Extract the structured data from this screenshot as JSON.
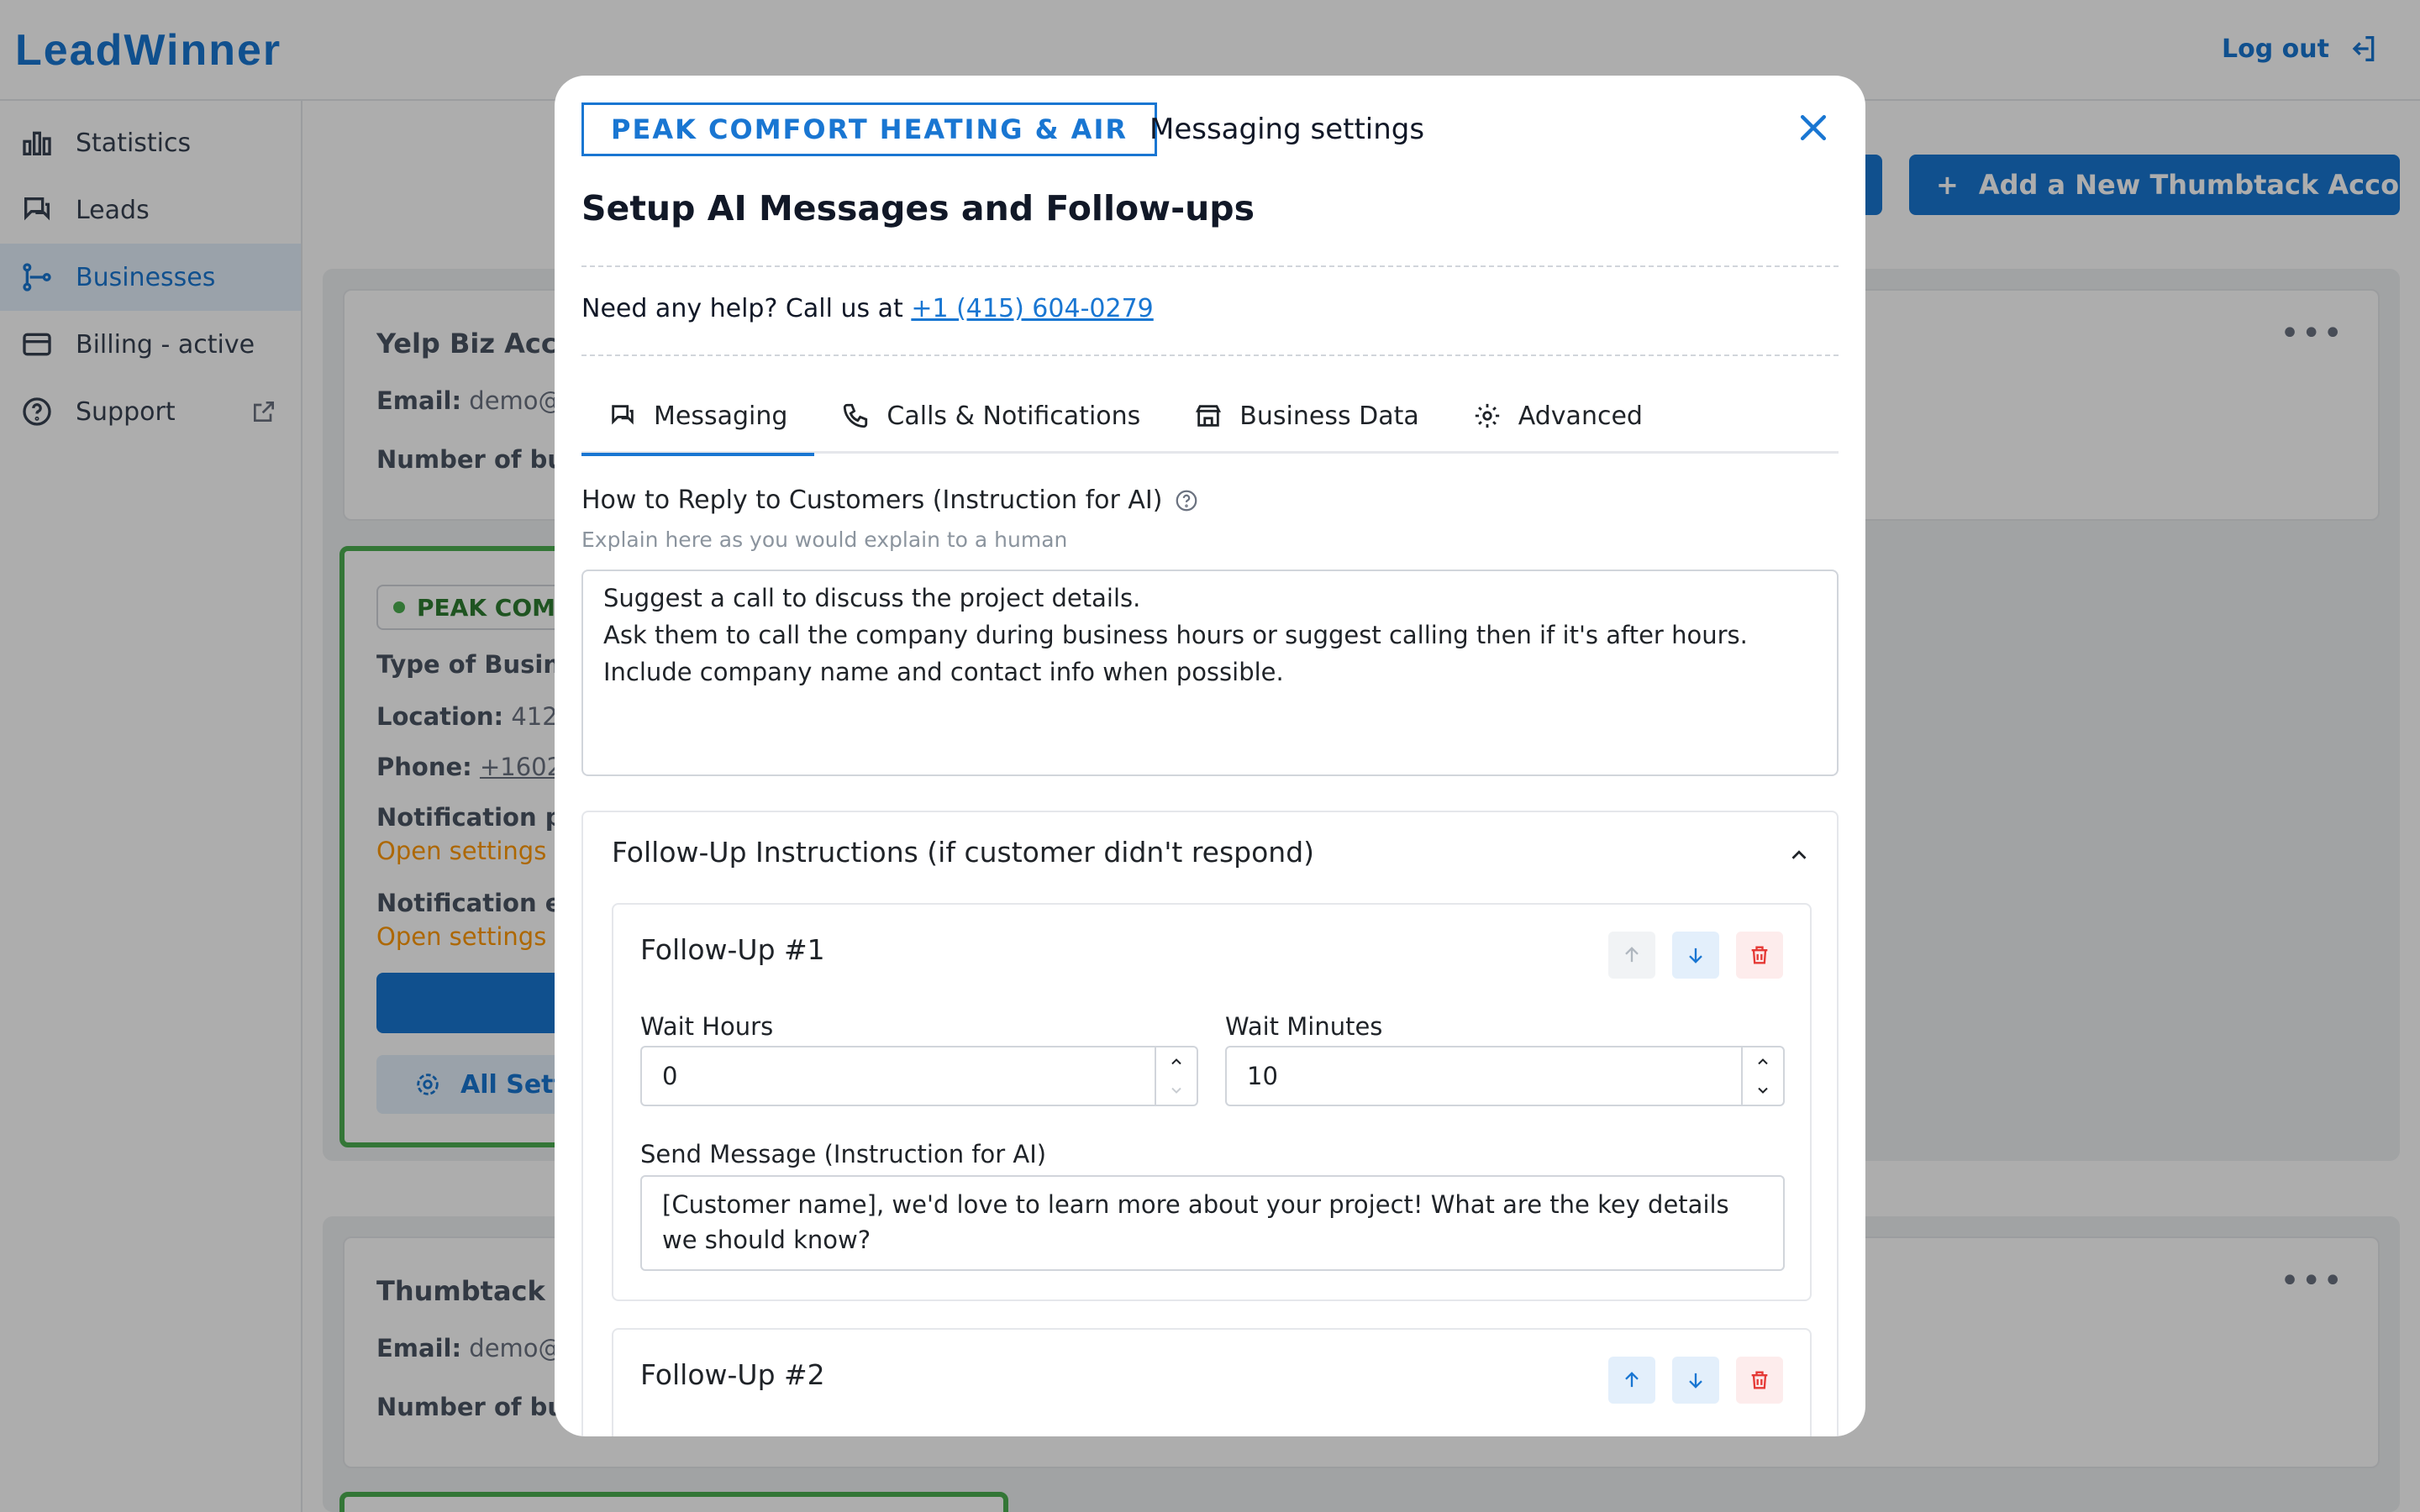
{
  "app": {
    "logo": "LeadWinner",
    "logout_label": "Log out",
    "sidebar": [
      {
        "label": "Statistics",
        "icon": "bar-chart-icon"
      },
      {
        "label": "Leads",
        "icon": "chat-icon"
      },
      {
        "label": "Businesses",
        "icon": "businesses-icon",
        "active": true
      },
      {
        "label": "Billing - active",
        "icon": "billing-icon"
      },
      {
        "label": "Support",
        "icon": "help-icon"
      }
    ],
    "add_thumbtack_label": "Add a New Thumbtack Acco",
    "cards": {
      "yelp_title": "Yelp Biz Acc",
      "email_label": "Email:",
      "email_value": "demo@",
      "number_label": "Number of bu",
      "peak_chip": "PEAK COM",
      "type_label": "Type of Busin",
      "location_label": "Location:",
      "location_value": "412",
      "phone_label": "Phone:",
      "phone_value": "+1602",
      "notif_p_label": "Notification p",
      "open_settings_1": "Open settings t",
      "notif_e_label": "Notification e",
      "open_settings_2": "Open settings t",
      "all_settings": "All Sett",
      "thumbtack_title": "Thumbtack",
      "email_label_2": "Email:",
      "email_value_2": "demo@",
      "number_label_2": "Number of bu"
    }
  },
  "modal": {
    "business_name": "PEAK COMFORT HEATING & AIR",
    "subtitle": "Messaging settings",
    "heading": "Setup AI Messages and Follow-ups",
    "help_text": "Need any help? Call us at",
    "help_phone": "+1 (415) 604-0279",
    "tabs": [
      {
        "label": "Messaging",
        "icon": "message-icon",
        "active": true
      },
      {
        "label": "Calls & Notifications",
        "icon": "phone-icon"
      },
      {
        "label": "Business Data",
        "icon": "store-icon"
      },
      {
        "label": "Advanced",
        "icon": "gear-icon"
      }
    ],
    "reply_label": "How to Reply to Customers (Instruction for AI)",
    "reply_hint": "Explain here as you would explain to a human",
    "reply_text": "Suggest a call to discuss the project details.\nAsk them to call the company during business hours or suggest calling then if it's after hours.\nInclude company name and contact info when possible.",
    "followup_header": "Follow-Up Instructions (if customer didn't respond)",
    "followups": [
      {
        "title": "Follow-Up #1",
        "wait_hours_label": "Wait Hours",
        "wait_hours": "0",
        "wait_minutes_label": "Wait Minutes",
        "wait_minutes": "10",
        "send_message_label": "Send Message (Instruction for AI)",
        "send_message": "[Customer name], we'd love to learn more about your project! What are the key details we should know?"
      },
      {
        "title": "Follow-Up #2"
      }
    ],
    "colors": {
      "accent": "#1976d2",
      "danger": "#e53935",
      "success": "#4caf50"
    }
  }
}
